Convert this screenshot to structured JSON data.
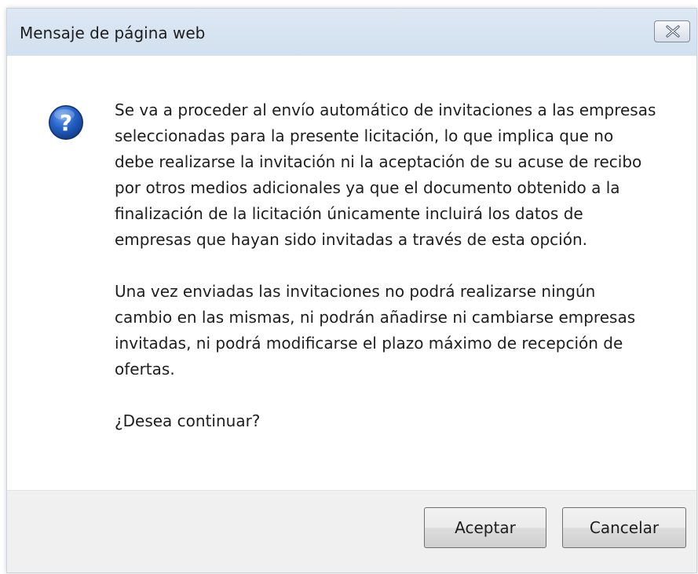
{
  "dialog": {
    "title": "Mensaje de página web",
    "icon": "question-icon",
    "paragraphs": [
      "Se va a proceder al envío automático de invitaciones a las empresas seleccionadas para la presente licitación, lo que implica que no debe realizarse la invitación ni la aceptación de su acuse de recibo por otros medios adicionales ya que el documento obtenido a la finalización de la licitación únicamente incluirá los datos de empresas que hayan sido invitadas a través de esta opción.",
      "Una vez enviadas las invitaciones no podrá realizarse ningún cambio en las mismas, ni podrán añadirse ni cambiarse empresas invitadas, ni podrá modificarse el plazo máximo de recepción de ofertas.",
      "¿Desea continuar?"
    ],
    "accept_label": "Aceptar",
    "cancel_label": "Cancelar"
  },
  "colors": {
    "titlebar": "#d7e4f1",
    "icon_blue": "#1f5fbf",
    "button_bar": "#f0f0f0"
  }
}
